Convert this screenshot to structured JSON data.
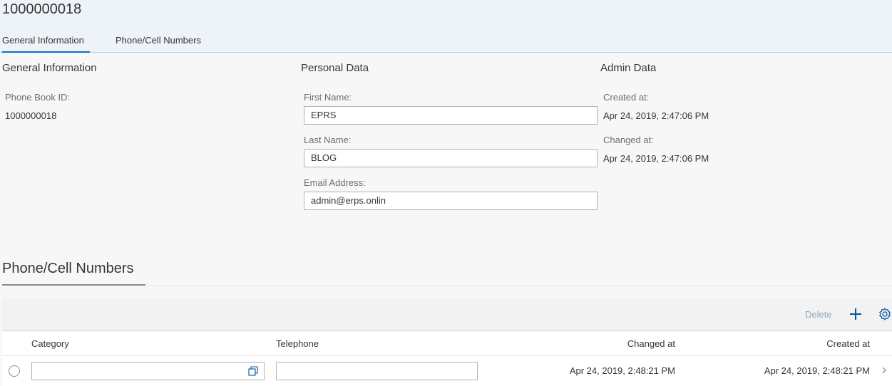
{
  "header": {
    "title": "1000000018",
    "tabs": [
      {
        "label": "General Information"
      },
      {
        "label": "Phone/Cell Numbers"
      }
    ]
  },
  "general": {
    "title": "General Information",
    "phone_book_id_label": "Phone Book ID:",
    "phone_book_id_value": "1000000018"
  },
  "personal": {
    "title": "Personal Data",
    "first_name_label": "First Name:",
    "first_name_value": "EPRS",
    "last_name_label": "Last Name:",
    "last_name_value": "BLOG",
    "email_label": "Email Address:",
    "email_value": "admin@erps.onlin"
  },
  "admin": {
    "title": "Admin Data",
    "created_label": "Created at:",
    "created_value": "Apr 24, 2019, 2:47:06 PM",
    "changed_label": "Changed at:",
    "changed_value": "Apr 24, 2019, 2:47:06 PM"
  },
  "phones": {
    "title": "Phone/Cell Numbers",
    "delete_label": "Delete",
    "columns": [
      "Category",
      "Telephone",
      "Changed at",
      "Created at"
    ],
    "rows": [
      {
        "category": "",
        "telephone": "",
        "changed_at": "Apr 24, 2019, 2:48:21 PM",
        "created_at": "Apr 24, 2019, 2:48:21 PM"
      }
    ]
  },
  "icons": {
    "add": "plus-icon",
    "settings": "gear-icon",
    "value_help": "value-help-icon",
    "navigation": "chevron-right-icon"
  },
  "colors": {
    "accent": "#0a6ed1",
    "header_bg": "#eef3f7"
  }
}
